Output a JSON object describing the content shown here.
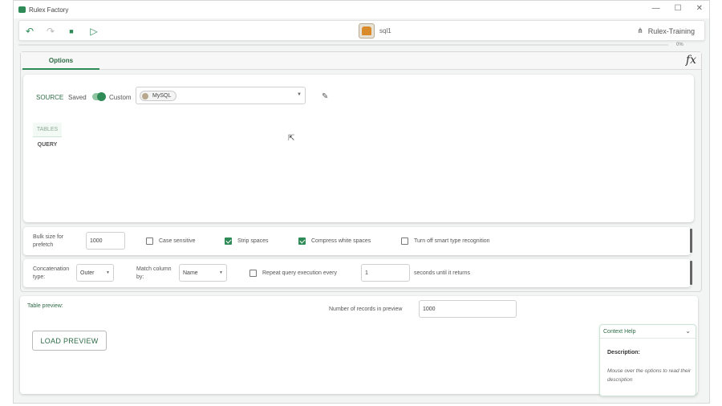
{
  "window": {
    "title": "Rulex Factory",
    "controls": {
      "minimize": "—",
      "maximize": "☐",
      "close": "✕"
    }
  },
  "toolbar": {
    "undo": "↶",
    "redo": "↷",
    "save": "■",
    "run": "▷",
    "node_title": "sql1",
    "workspace": "Rulex-Training",
    "workspace_icon": "⋔"
  },
  "progress": {
    "value": 0,
    "label": "0%"
  },
  "options": {
    "tab_label": "Options",
    "fx": "fx",
    "source": {
      "label": "SOURCE",
      "saved_label": "Saved",
      "custom_label": "Custom",
      "selected": "MySQL",
      "arrow": "▼",
      "edit_icon": "✎"
    },
    "subtabs": [
      "TABLES",
      "QUERY"
    ],
    "cursor": "⇱",
    "row1": {
      "bulk_label": "Bulk size for prefetch",
      "bulk_value": "1000",
      "case_label": "Case sensitive",
      "case_checked": false,
      "strip_label": "Strip spaces",
      "strip_checked": true,
      "compress_label": "Compress white spaces",
      "compress_checked": true,
      "smart_label": "Turn off smart type recognition",
      "smart_checked": false
    },
    "row2": {
      "concat_label": "Concatenation type:",
      "concat_value": "Outer",
      "match_label": "Match column by:",
      "match_value": "Name",
      "repeat_label": "Repeat query execution every",
      "repeat_checked": false,
      "repeat_value": "1",
      "seconds_label": "seconds until it returns",
      "arrow": "▼"
    }
  },
  "preview": {
    "label": "Table preview:",
    "nrec_label": "Number of records in preview",
    "nrec_value": "1000",
    "load_button": "LOAD PREVIEW"
  },
  "help": {
    "title": "Context Help",
    "chevron": "⌄",
    "desc_label": "Description:",
    "desc_text": "Mouse over the options to read their description"
  },
  "colors": {
    "accent": "#2e8b57",
    "text": "#333333",
    "panel": "#f3f4f4"
  }
}
